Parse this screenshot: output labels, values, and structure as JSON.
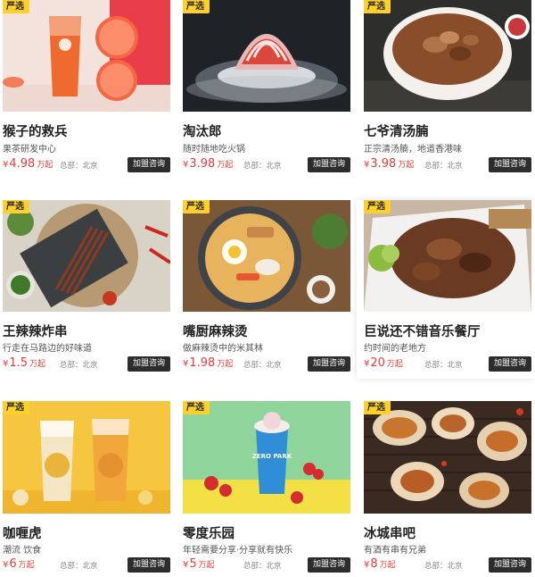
{
  "badge_label": "严选",
  "colors": {
    "price": "#ee3c39",
    "badge": "#ffd02a",
    "button": "#2d2d2d"
  },
  "cards": [
    {
      "name": "猴子的救兵",
      "desc": "果茶研发中心",
      "currency": "¥",
      "price": "4.98",
      "unit": "万起",
      "hq": "总部：北京",
      "cta": "加盟咨询",
      "image": "grapefruit-tea-photo"
    },
    {
      "name": "淘汰郎",
      "desc": "随时随地吃火锅",
      "currency": "¥",
      "price": "3.98",
      "unit": "万起",
      "hq": "总部：北京",
      "cta": "加盟咨询",
      "image": "beef-roll-hotpot-photo"
    },
    {
      "name": "七爷清汤腩",
      "desc": "正宗清汤腩，地道香港味",
      "currency": "¥",
      "price": "3.98",
      "unit": "万起",
      "hq": "总部：北京",
      "cta": "加盟咨询",
      "image": "beef-brisket-bowl-photo"
    },
    {
      "name": "王辣辣炸串",
      "desc": "行走在马路边的好味道",
      "currency": "¥",
      "price": "1.5",
      "unit": "万起",
      "hq": "总部：北京",
      "cta": "加盟咨询",
      "image": "skewers-photo"
    },
    {
      "name": "嘴厨麻辣烫",
      "desc": "做麻辣烫中的米其林",
      "currency": "¥",
      "price": "1.98",
      "unit": "万起",
      "hq": "总部：北京",
      "cta": "加盟咨询",
      "image": "malatang-bowl-photo"
    },
    {
      "name": "巨说还不错音乐餐厅",
      "desc": "约时间的老地方",
      "currency": "¥",
      "price": "20",
      "unit": "万起",
      "hq": "总部：北京",
      "cta": "加盟咨询",
      "image": "bbq-ribs-photo"
    },
    {
      "name": "咖喱虎",
      "desc": "潮流 饮食",
      "currency": "¥",
      "price": "6",
      "unit": "万起",
      "hq": "总部：北京",
      "cta": "加盟咨询",
      "image": "milk-tea-cups-photo"
    },
    {
      "name": "零度乐园",
      "desc": "年轻需要分享·分享就有快乐",
      "currency": "¥",
      "price": "5",
      "unit": "万起",
      "hq": "总部：北京",
      "cta": "加盟咨询",
      "image": "zero-park-drink-photo"
    },
    {
      "name": "冰城串吧",
      "desc": "有酒有串有兄弟",
      "currency": "¥",
      "price": "8",
      "unit": "万起",
      "hq": "总部：北京",
      "cta": "加盟咨询",
      "image": "grilled-oysters-photo"
    }
  ],
  "zero_park_cup_text": "ZERO PARK"
}
